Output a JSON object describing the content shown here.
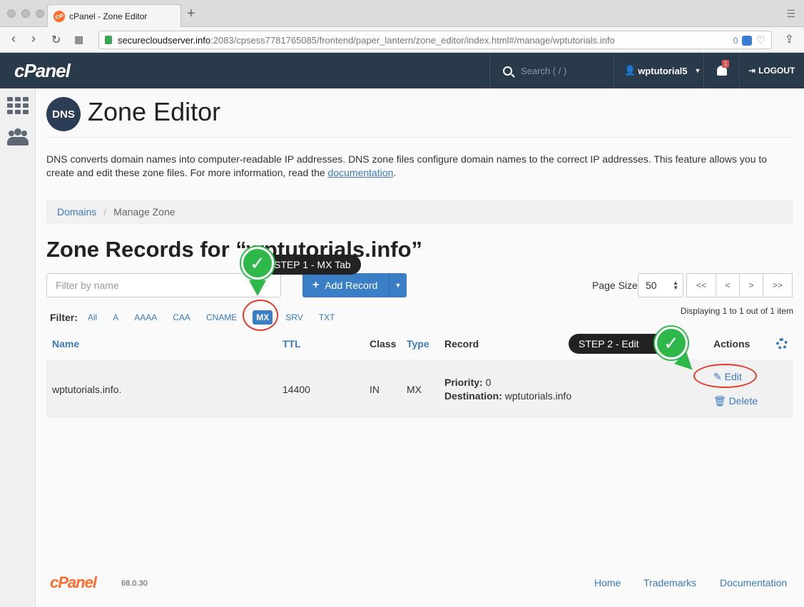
{
  "browser": {
    "tab_title": "cPanel - Zone Editor",
    "favicon_text": "cP",
    "url_domain": "securecloudserver.info",
    "url_path": ":2083/cpsess7781765085/frontend/paper_lantern/zone_editor/index.html#/manage/wptutorials.info",
    "url_counter": "0"
  },
  "header": {
    "logo": "cPanel",
    "search_placeholder": "Search ( / )",
    "username": "wptutorial5",
    "notification_count": "1",
    "logout_label": "LOGOUT"
  },
  "page": {
    "dns_badge": "DNS",
    "title": "Zone Editor",
    "description": "DNS converts domain names into computer-readable IP addresses. DNS zone files configure domain names to the correct IP addresses. This feature allows you to create and edit these zone files. For more information, read the ",
    "doc_link": "documentation",
    "desc_end": ".",
    "breadcrumb": {
      "home": "Domains",
      "separator": "/",
      "current": "Manage Zone"
    },
    "records_title": "Zone Records for “wptutorials.info”"
  },
  "toolbar": {
    "filter_placeholder": "Filter by name",
    "add_record_label": "Add Record",
    "page_size_label": "Page Size",
    "page_size_value": "50",
    "pager": [
      "<<",
      "<",
      ">",
      ">>"
    ],
    "displaying": "Displaying 1 to 1 out of 1 item"
  },
  "filters": {
    "label": "Filter:",
    "options": [
      "All",
      "A",
      "AAAA",
      "CAA",
      "CNAME",
      "MX",
      "SRV",
      "TXT"
    ],
    "active": "MX"
  },
  "table": {
    "headers": {
      "name": "Name",
      "ttl": "TTL",
      "class": "Class",
      "type": "Type",
      "record": "Record",
      "actions": "Actions"
    },
    "row": {
      "name": "wptutorials.info.",
      "ttl": "14400",
      "class": "IN",
      "type": "MX",
      "priority_label": "Priority:",
      "priority_value": "0",
      "destination_label": "Destination:",
      "destination_value": "wptutorials.info",
      "edit_label": "Edit",
      "delete_label": "Delete"
    }
  },
  "annotations": {
    "step1": "STEP 1 -  MX Tab",
    "step2": "STEP 2 - Edit",
    "check": "✓",
    "accent": "#2fb84a",
    "ring_color": "#e23b2b"
  },
  "footer": {
    "logo": "cPanel",
    "version": "68.0.30",
    "links": [
      "Home",
      "Trademarks",
      "Documentation"
    ]
  }
}
